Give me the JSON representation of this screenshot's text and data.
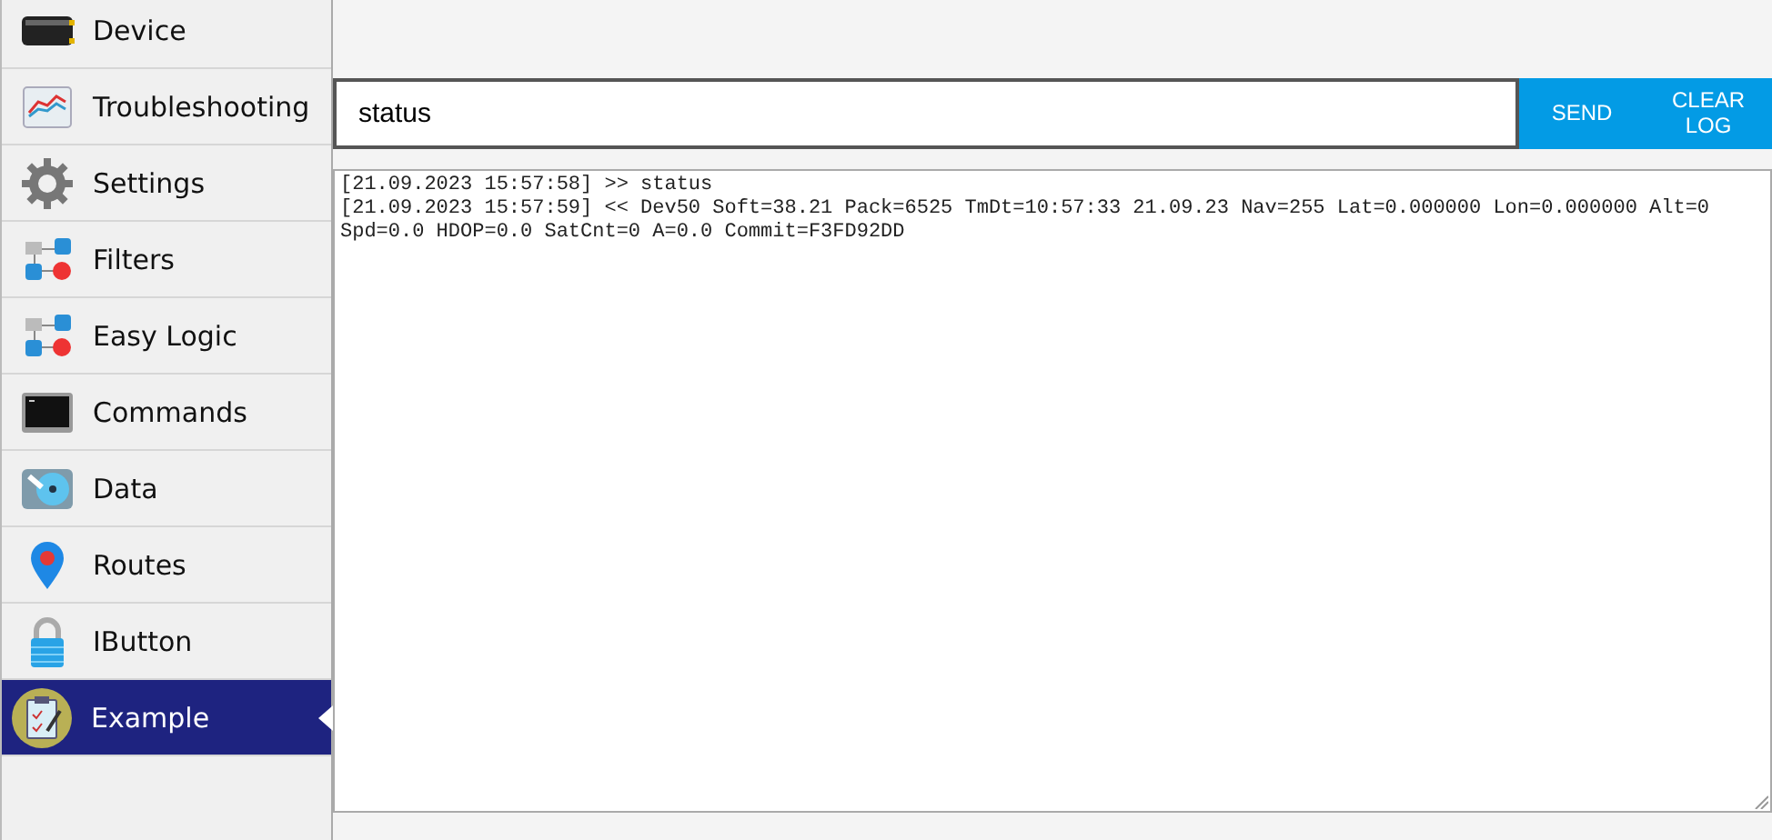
{
  "sidebar": {
    "items": [
      {
        "label": "Device",
        "selected": false
      },
      {
        "label": "Troubleshooting",
        "selected": false
      },
      {
        "label": "Settings",
        "selected": false
      },
      {
        "label": "Filters",
        "selected": false
      },
      {
        "label": "Easy Logic",
        "selected": false
      },
      {
        "label": "Commands",
        "selected": false
      },
      {
        "label": "Data",
        "selected": false
      },
      {
        "label": "Routes",
        "selected": false
      },
      {
        "label": "IButton",
        "selected": false
      },
      {
        "label": "Example",
        "selected": true
      }
    ]
  },
  "command": {
    "value": "status"
  },
  "buttons": [
    {
      "label": "SEND"
    },
    {
      "label": "CLEAR LOG"
    }
  ],
  "log": [
    "[21.09.2023 15:57:58] >> status",
    "[21.09.2023 15:57:59] << Dev50 Soft=38.21 Pack=6525 TmDt=10:57:33 21.09.23 Nav=255 Lat=0.000000 Lon=0.000000 Alt=0 Spd=0.0 HDOP=0.0 SatCnt=0 A=0.0 Commit=F3FD92DD"
  ]
}
